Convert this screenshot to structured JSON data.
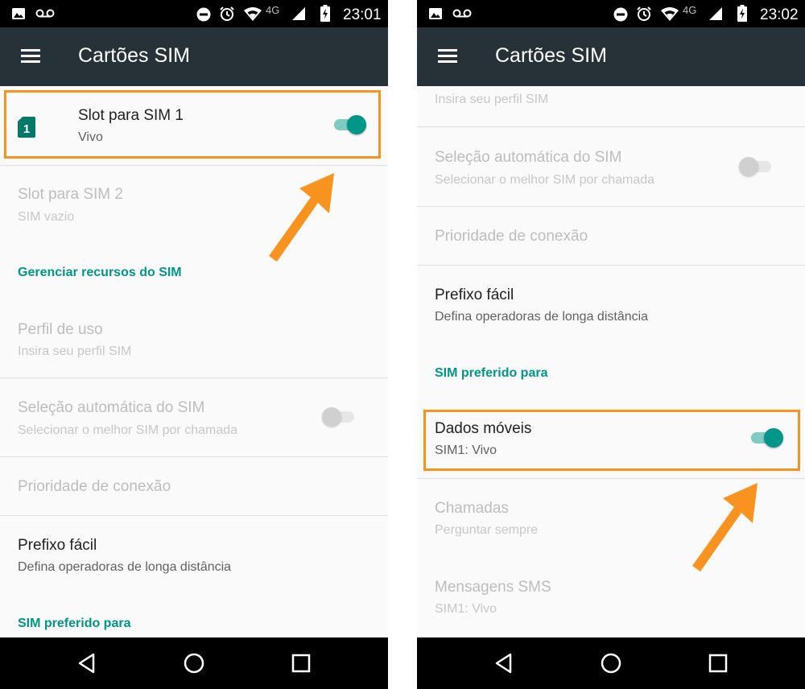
{
  "colors": {
    "accent": "#009688",
    "highlight": "#f7931e",
    "app_bar": "#263238"
  },
  "screens": [
    {
      "status": {
        "time": "23:01",
        "network": "4G"
      },
      "title": "Cartões SIM",
      "sim_slots": [
        {
          "title": "Slot para SIM 1",
          "subtitle": "Vivo",
          "enabled": true,
          "badge": "1"
        },
        {
          "title": "Slot para SIM 2",
          "subtitle": "SIM vazio",
          "enabled": false
        }
      ],
      "section_manage": "Gerenciar recursos do SIM",
      "profile": {
        "title": "Perfil de uso",
        "subtitle": "Insira seu perfil SIM"
      },
      "auto_select": {
        "title": "Seleção automática do SIM",
        "subtitle": "Selecionar o melhor SIM por chamada"
      },
      "priority": {
        "title": "Prioridade de conexão"
      },
      "prefix": {
        "title": "Prefixo fácil",
        "subtitle": "Defina operadoras de longa distância"
      },
      "section_preferred": "SIM preferido para"
    },
    {
      "status": {
        "time": "23:02",
        "network": "4G"
      },
      "title": "Cartões SIM",
      "profile_subtitle": "Insira seu perfil SIM",
      "auto_select": {
        "title": "Seleção automática do SIM",
        "subtitle": "Selecionar o melhor SIM por chamada"
      },
      "priority": {
        "title": "Prioridade de conexão"
      },
      "prefix": {
        "title": "Prefixo fácil",
        "subtitle": "Defina operadoras de longa distância"
      },
      "section_preferred": "SIM preferido para",
      "mobile_data": {
        "title": "Dados móveis",
        "subtitle": "SIM1: Vivo",
        "enabled": true
      },
      "calls": {
        "title": "Chamadas",
        "subtitle": "Perguntar sempre"
      },
      "sms": {
        "title": "Mensagens SMS",
        "subtitle": "SIM1: Vivo"
      }
    }
  ],
  "icons": {
    "status_left": [
      "image-icon",
      "voicemail-icon"
    ],
    "status_right": [
      "do-not-disturb-icon",
      "alarm-icon",
      "wifi-icon",
      "signal-icon",
      "battery-charging-icon"
    ],
    "nav": [
      "back-icon",
      "home-icon",
      "recents-icon"
    ]
  }
}
